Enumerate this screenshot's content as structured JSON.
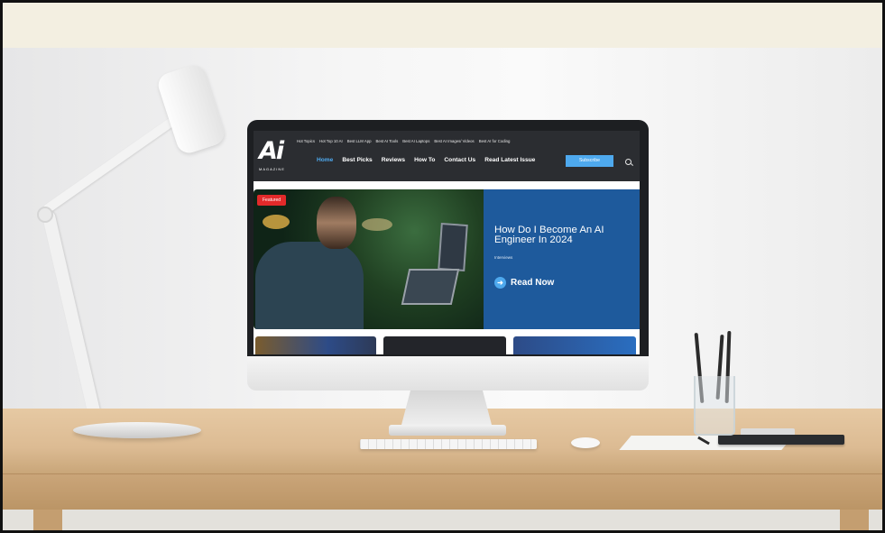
{
  "website": {
    "logo_text": "Ai",
    "logo_subtext": "MAGAZINE",
    "top_links": [
      "Hot Topics",
      "Hot Top 10 AI",
      "Best LLM App",
      "Best AI Tools",
      "Best AI Laptops",
      "Best AI Images/ Videos",
      "Best AI for Coding"
    ],
    "main_nav": [
      "Home",
      "Best Picks",
      "Reviews",
      "How To",
      "Contact Us",
      "Read Latest Issue"
    ],
    "active_nav": "Home",
    "subscribe_label": "Subscribe",
    "search_icon": "search-icon",
    "featured": {
      "tag": "Featured",
      "title": "How Do I Become An AI Engineer In 2024",
      "category": "Interviews",
      "cta_label": "Read Now",
      "cta_icon": "arrow-right-circle-icon"
    }
  },
  "colors": {
    "accent_blue": "#4ea9ee",
    "feature_panel": "#1e5a9c",
    "featured_tag": "#e12a2a",
    "header_bg": "#2b2d31"
  }
}
